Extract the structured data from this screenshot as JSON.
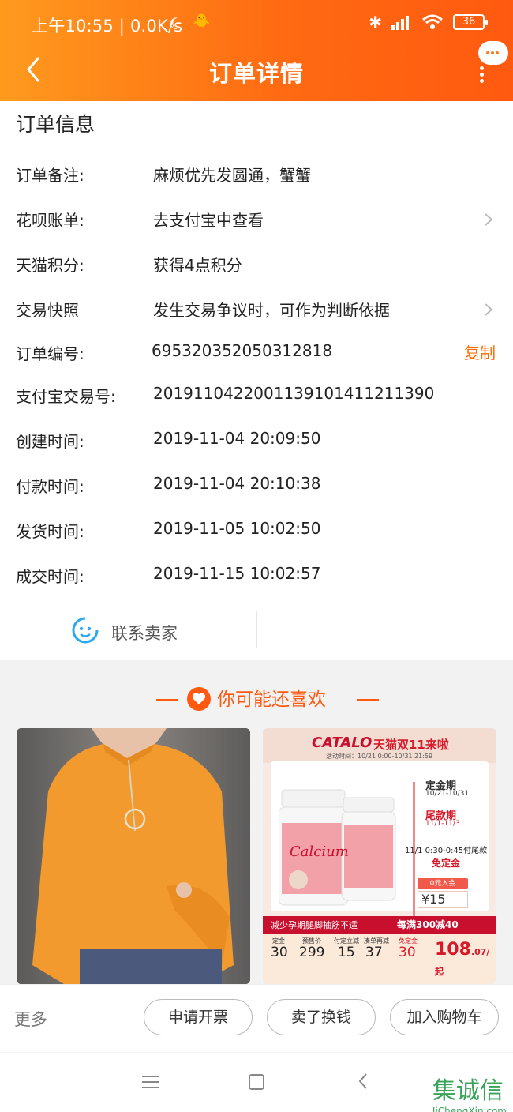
{
  "status_bar": {
    "time": "上午10:55 | 0.0K/s",
    "battery": "36"
  },
  "header": {
    "title": "订单详情"
  },
  "order_info": {
    "section_title": "订单信息",
    "rows": [
      {
        "label": "订单备注:",
        "value": "麻烦优先发圆通，蟹蟹"
      },
      {
        "label": "花呗账单:",
        "value": "去支付宝中查看"
      },
      {
        "label": "天猫积分:",
        "value": "获得4点积分"
      },
      {
        "label": "交易快照",
        "value": "发生交易争议时，可作为判断依据"
      },
      {
        "label": "订单编号:",
        "value": "695320352050312818",
        "action": "复制"
      },
      {
        "label": "支付宝交易号:",
        "value": "2019110422001139101411211390"
      },
      {
        "label": "创建时间:",
        "value": "2019-11-04 20:09:50"
      },
      {
        "label": "付款时间:",
        "value": "2019-11-04 20:10:38"
      },
      {
        "label": "发货时间:",
        "value": "2019-11-05 10:02:50"
      },
      {
        "label": "成交时间:",
        "value": "2019-11-15 10:02:57"
      }
    ],
    "contact_seller": "联系卖家"
  },
  "recommend": {
    "title": "你可能还喜欢",
    "ad": {
      "brand": "CATALO",
      "campaign": "天猫双11来啦",
      "activity_time": "活动时间：10/21 0:00-10/31 21:59",
      "deposit_period": "定金期",
      "deposit_dates": "10/21-10/31",
      "final_period": "尾款期",
      "final_dates": "11/1-11/3",
      "final_free_time": "11/1 0:30-0:45付尾款",
      "free_deposit": "免定金",
      "zero_join": "0元入会",
      "price_tag": "¥15",
      "product_word": "Calcium",
      "banner_left": "减少孕期腿脚抽筋不适",
      "banner_right": "每满300减40",
      "deposit_label": "定金",
      "deposit_value": "30",
      "presale_label": "预售价",
      "presale_value": "299",
      "deduct_label": "付定立减",
      "deduct_value": "15",
      "full_label": "凑单再减",
      "full_value": "37",
      "free_label": "免定金",
      "free_value": "30",
      "final_price": "108",
      "final_price_suffix": ".07/起"
    }
  },
  "actions": {
    "more": "更多",
    "invoice": "申请开票",
    "resell": "卖了换钱",
    "add_cart": "加入购物车"
  },
  "watermark": {
    "text": "集诚信",
    "domain": "JiChengXin.com"
  }
}
